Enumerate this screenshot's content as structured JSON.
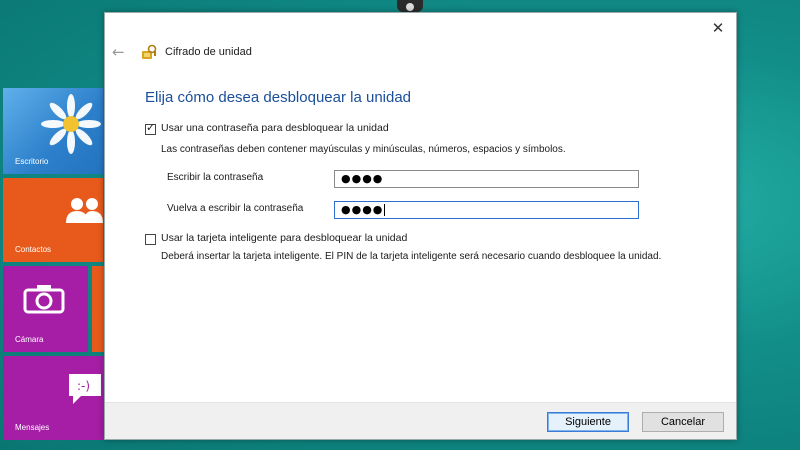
{
  "start_tiles": [
    {
      "label": "Escritorio"
    },
    {
      "label": "Contactos"
    },
    {
      "label": "Cámara"
    },
    {
      "label": "Mensajes"
    }
  ],
  "dialog": {
    "title": "Cifrado de unidad",
    "close_glyph": "✕",
    "back_glyph": "←",
    "heading": "Elija cómo desea desbloquear la unidad",
    "option_password": {
      "checked": true,
      "label": "Usar una contraseña para desbloquear la unidad",
      "description": "Las contraseñas deben contener mayúsculas y minúsculas, números, espacios y símbolos.",
      "password_label": "Escribir la contraseña",
      "password_value": "●●●●",
      "confirm_label": "Vuelva a escribir la contraseña",
      "confirm_value": "●●●●"
    },
    "option_smartcard": {
      "checked": false,
      "label": "Usar la tarjeta inteligente para desbloquear la unidad",
      "description": "Deberá insertar la tarjeta inteligente. El PIN de la tarjeta inteligente será necesario cuando desbloquee la unidad."
    },
    "buttons": {
      "next": "Siguiente",
      "cancel": "Cancelar"
    }
  },
  "colors": {
    "desktop_bg": "#0e8a86",
    "heading": "#1a4f9c",
    "tile_blue": "#3a8fd6",
    "tile_orange": "#e85a1b",
    "tile_purple": "#a51ea5"
  },
  "icons": {
    "title": "bitlocker-key-icon",
    "back": "back-arrow-icon",
    "close": "close-icon",
    "contacts": "people-icon",
    "camera": "camera-icon",
    "messages": "chat-bubble-icon",
    "desktop": "daisy-flower-icon"
  }
}
